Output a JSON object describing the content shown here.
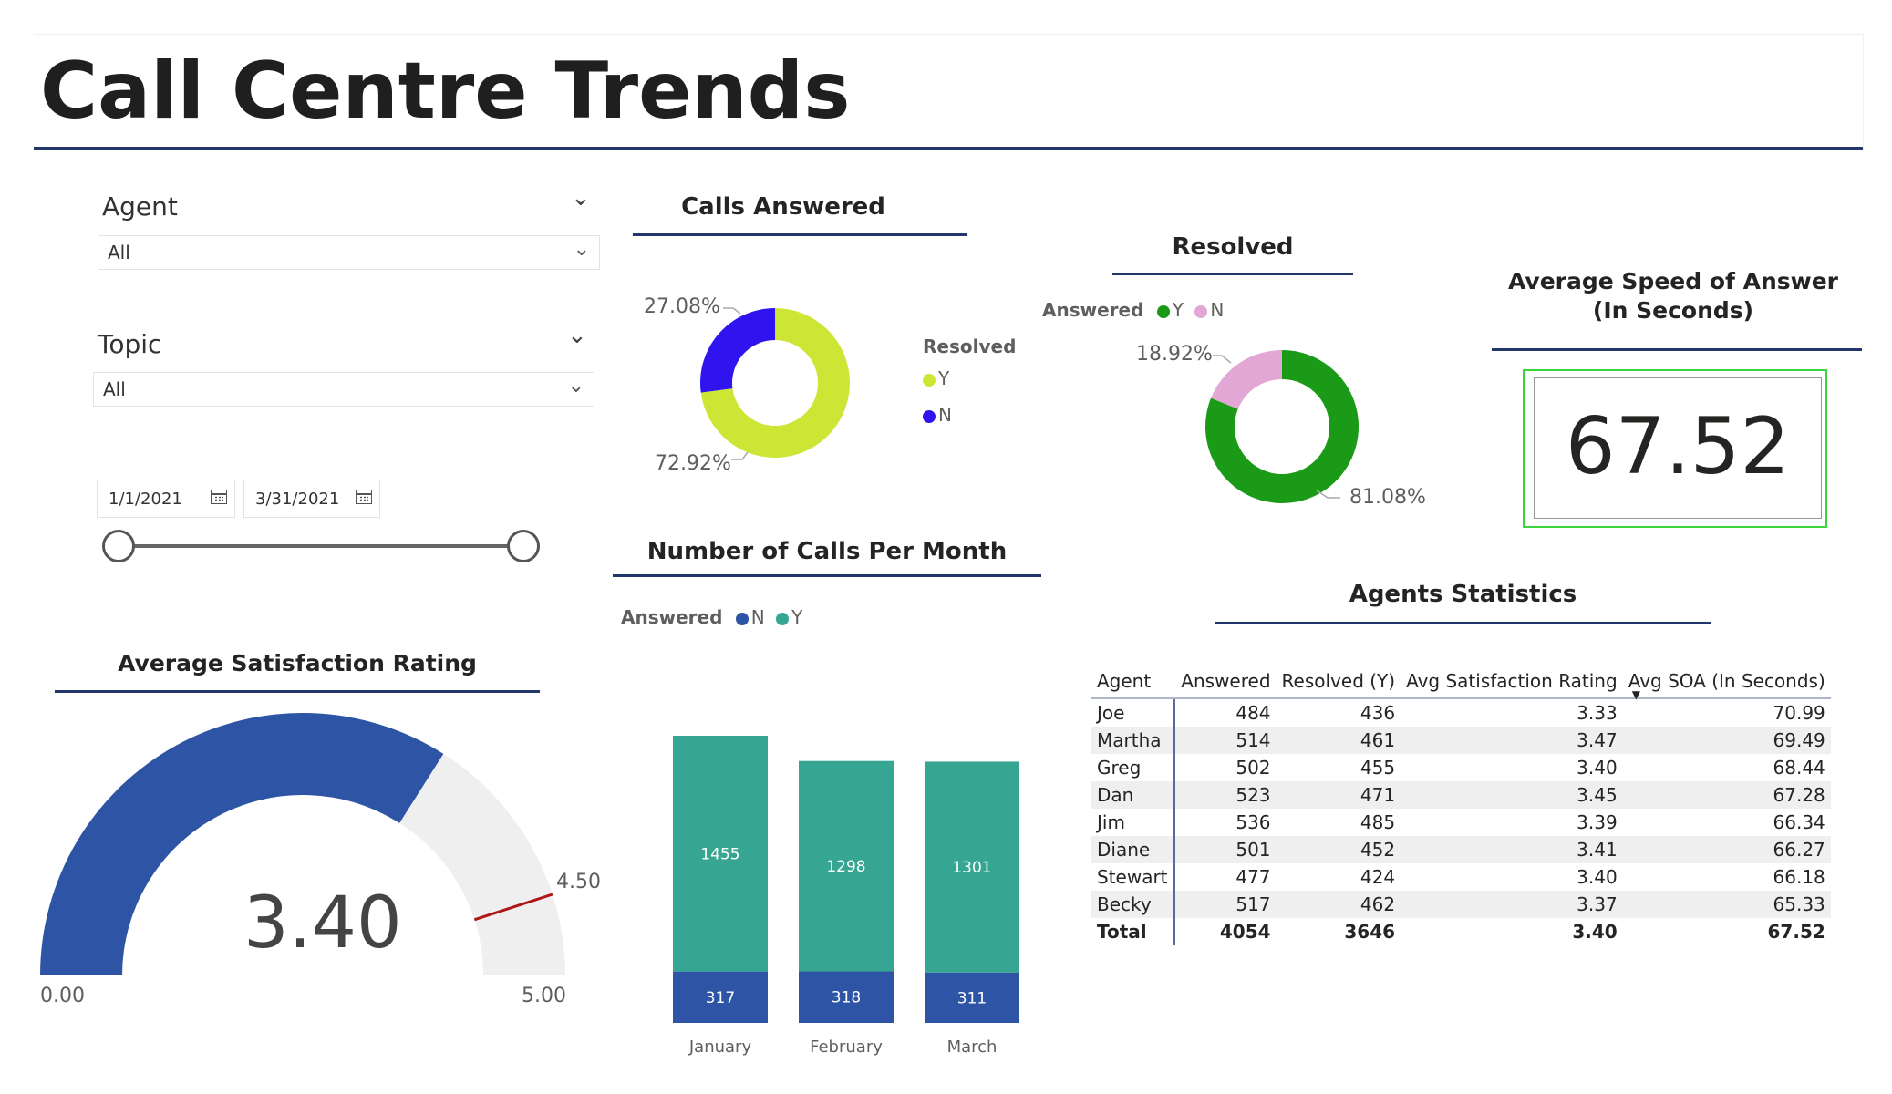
{
  "title": "Call Centre Trends",
  "filters": {
    "agent": {
      "label": "Agent",
      "value": "All"
    },
    "topic": {
      "label": "Topic",
      "value": "All"
    },
    "date_start": "1/1/2021",
    "date_end": "3/31/2021"
  },
  "calls_answered": {
    "title": "Calls Answered",
    "legend_title": "Resolved",
    "labels": {
      "y": "Y",
      "n": "N"
    },
    "pct_y": "72.92%",
    "pct_n": "27.08%",
    "colors": {
      "y": "#cde635",
      "n": "#2f14ef"
    }
  },
  "resolved": {
    "title": "Resolved",
    "legend_title": "Answered",
    "labels": {
      "y": "Y",
      "n": "N"
    },
    "pct_y": "81.08%",
    "pct_n": "18.92%",
    "colors": {
      "y": "#1a9a16",
      "n": "#e3a7d5"
    }
  },
  "asa": {
    "title_line1": "Average Speed of Answer",
    "title_line2": "(In Seconds)",
    "value": "67.52"
  },
  "calls_per_month": {
    "title": "Number of Calls Per Month",
    "legend_title": "Answered",
    "labels": {
      "n": "N",
      "y": "Y"
    },
    "colors": {
      "n": "#2e55a5",
      "y": "#36a693"
    }
  },
  "agents_stats": {
    "title": "Agents Statistics",
    "columns": [
      "Agent",
      "Answered",
      "Resolved (Y)",
      "Avg Satisfaction Rating",
      "Avg SOA (In Seconds)"
    ],
    "rows": [
      [
        "Joe",
        "484",
        "436",
        "3.33",
        "70.99"
      ],
      [
        "Martha",
        "514",
        "461",
        "3.47",
        "69.49"
      ],
      [
        "Greg",
        "502",
        "455",
        "3.40",
        "68.44"
      ],
      [
        "Dan",
        "523",
        "471",
        "3.45",
        "67.28"
      ],
      [
        "Jim",
        "536",
        "485",
        "3.39",
        "66.34"
      ],
      [
        "Diane",
        "501",
        "452",
        "3.41",
        "66.27"
      ],
      [
        "Stewart",
        "477",
        "424",
        "3.40",
        "66.18"
      ],
      [
        "Becky",
        "517",
        "462",
        "3.37",
        "65.33"
      ]
    ],
    "total": [
      "Total",
      "4054",
      "3646",
      "3.40",
      "67.52"
    ]
  },
  "satisfaction": {
    "title": "Average Satisfaction Rating",
    "value": "3.40",
    "min": "0.00",
    "max": "5.00",
    "target": "4.50",
    "colors": {
      "fill": "#2e55a5",
      "track": "#efefef",
      "target": "#b01515"
    }
  },
  "chart_data": [
    {
      "type": "pie",
      "title": "Calls Answered",
      "legend_title": "Resolved",
      "categories": [
        "Y",
        "N"
      ],
      "values": [
        72.92,
        27.08
      ]
    },
    {
      "type": "pie",
      "title": "Resolved",
      "legend_title": "Answered",
      "categories": [
        "Y",
        "N"
      ],
      "values": [
        81.08,
        18.92
      ]
    },
    {
      "type": "bar",
      "stacked": true,
      "title": "Number of Calls Per Month",
      "legend_title": "Answered",
      "categories": [
        "January",
        "February",
        "March"
      ],
      "series": [
        {
          "name": "N",
          "values": [
            317,
            318,
            311
          ]
        },
        {
          "name": "Y",
          "values": [
            1455,
            1298,
            1301
          ]
        }
      ]
    },
    {
      "type": "gauge",
      "title": "Average Satisfaction Rating",
      "value": 3.4,
      "min": 0,
      "max": 5,
      "target": 4.5
    }
  ]
}
